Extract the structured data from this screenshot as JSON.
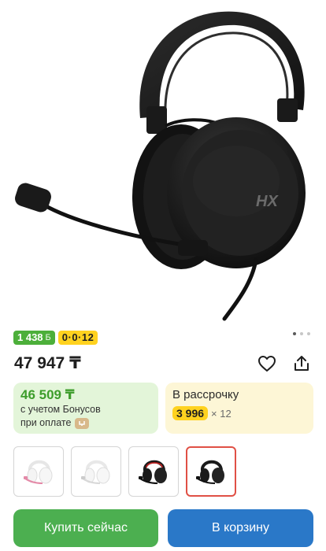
{
  "product_image": {
    "alt": "HyperX headset",
    "logo_text": "HX"
  },
  "gallery_dots": {
    "count": 3,
    "active_index": 1
  },
  "badges": {
    "bonus_value": "1 438",
    "bonus_currency": "Б",
    "installment": "0·0·12"
  },
  "price": {
    "main": "47 947 ₸"
  },
  "actions": {
    "favorite_icon": "heart-icon",
    "share_icon": "share-icon"
  },
  "bonus_card": {
    "price": "46 509 ₸",
    "line1": "с учетом Бонусов",
    "line2": "при оплате"
  },
  "installment_card": {
    "title": "В рассрочку",
    "amount": "3 996",
    "times": "× 12"
  },
  "variants": [
    {
      "name": "white-pink",
      "selected": false
    },
    {
      "name": "white",
      "selected": false
    },
    {
      "name": "black-red",
      "selected": false
    },
    {
      "name": "black",
      "selected": true
    }
  ],
  "buttons": {
    "buy_now": "Купить сейчас",
    "add_to_cart": "В корзину"
  },
  "colors": {
    "green": "#4caf50",
    "blue": "#2a78c8",
    "yellow": "#ffd21f",
    "bonus_green": "#3d9d2b",
    "selected_border": "#e05045"
  }
}
